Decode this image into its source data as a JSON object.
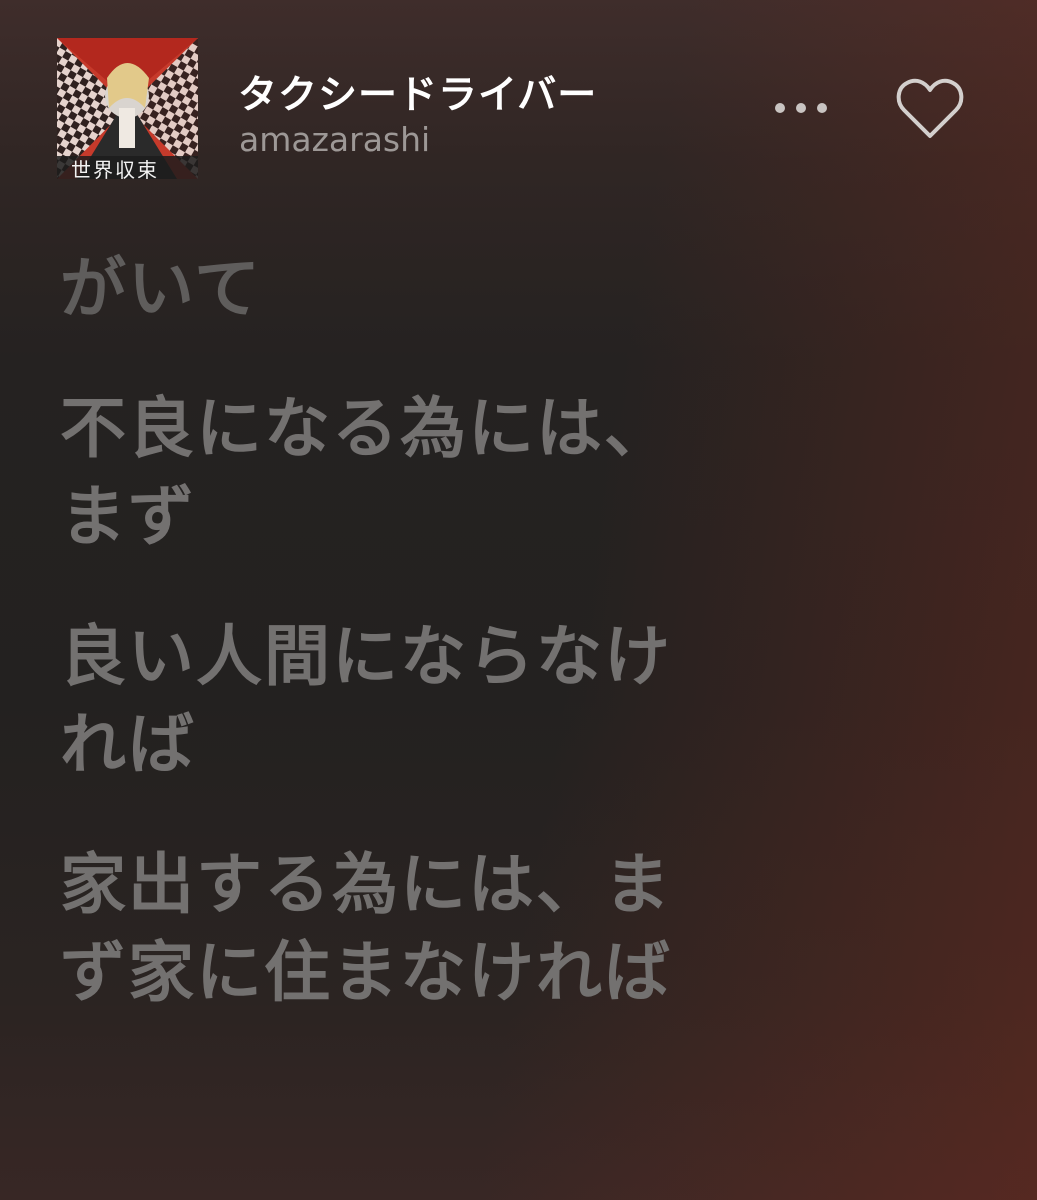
{
  "track": {
    "title": "タクシードライバー",
    "artist": "amazarashi",
    "album_art_text": "世界収束"
  },
  "icons": {
    "more": "more-horizontal-icon",
    "like": "heart-outline-icon"
  },
  "colors": {
    "title": "#ffffff",
    "artist": "#9d9896",
    "lyrics": "#737170",
    "accent_glow": "#6e2a1e"
  },
  "lyrics": [
    {
      "text": "がいて"
    },
    {
      "text": "不良になる為には、\nまず"
    },
    {
      "text": "良い人間にならなけ\nれば"
    },
    {
      "text": "家出する為には、ま\nず家に住まなければ"
    }
  ]
}
